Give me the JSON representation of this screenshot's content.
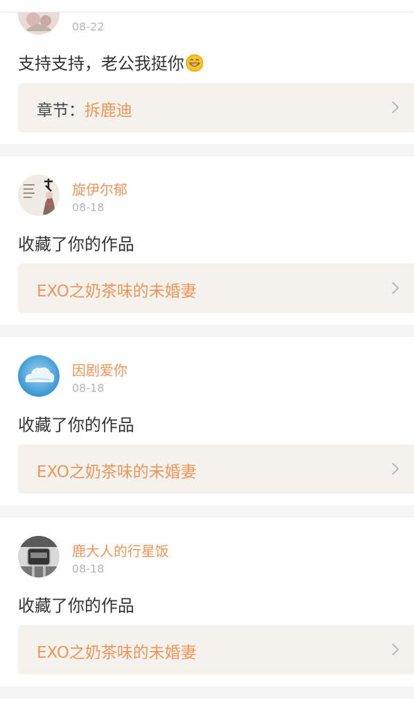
{
  "items": [
    {
      "date": "08-22",
      "text": "支持支持，老公我挺你",
      "link_prefix": "章节：",
      "link_title": "拆鹿迪",
      "emoji_icon": "grinning-face-icon"
    },
    {
      "name": "旋伊尔郁",
      "date": "08-18",
      "text": "收藏了你的作品",
      "link_title": "EXO之奶茶味的未婚妻"
    },
    {
      "name": "因剧爱你",
      "date": "08-18",
      "text": "收藏了你的作品",
      "link_title": "EXO之奶茶味的未婚妻"
    },
    {
      "name": "鹿大人的行星饭",
      "date": "08-18",
      "text": "收藏了你的作品",
      "link_title": "EXO之奶茶味的未婚妻"
    }
  ],
  "colors": {
    "accent": "#f0955a",
    "link_bg": "#f3f2ec",
    "page_bg": "#f5f5f5",
    "date": "#b5b5b5"
  }
}
